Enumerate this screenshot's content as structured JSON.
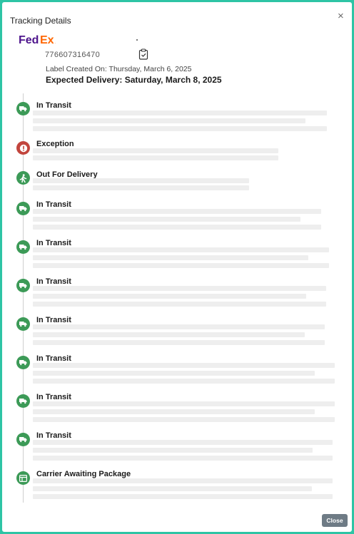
{
  "dialog": {
    "title": "Tracking Details",
    "close_icon": "×",
    "close_button_label": "Close"
  },
  "shipment": {
    "carrier": "FedEx",
    "tracking_number": "776607316470",
    "label_created": "Label Created On: Thursday, March 6, 2025",
    "expected_delivery": "Expected Delivery: Saturday, March 8, 2025"
  },
  "events": [
    {
      "status": "In Transit",
      "icon": "truck-icon"
    },
    {
      "status": "Exception",
      "icon": "alert-icon"
    },
    {
      "status": "Out For Delivery",
      "icon": "walking-person-icon"
    },
    {
      "status": "In Transit",
      "icon": "truck-icon"
    },
    {
      "status": "In Transit",
      "icon": "truck-icon"
    },
    {
      "status": "In Transit",
      "icon": "truck-icon"
    },
    {
      "status": "In Transit",
      "icon": "truck-icon"
    },
    {
      "status": "In Transit",
      "icon": "truck-icon"
    },
    {
      "status": "In Transit",
      "icon": "truck-icon"
    },
    {
      "status": "In Transit",
      "icon": "truck-icon"
    },
    {
      "status": "Carrier Awaiting Package",
      "icon": "package-icon"
    }
  ],
  "colors": {
    "status_green": "#3c9a57",
    "status_red": "#c2453d",
    "fedex_purple": "#4d148c",
    "fedex_orange": "#ff6600",
    "backdrop": "#2ec4a5"
  }
}
